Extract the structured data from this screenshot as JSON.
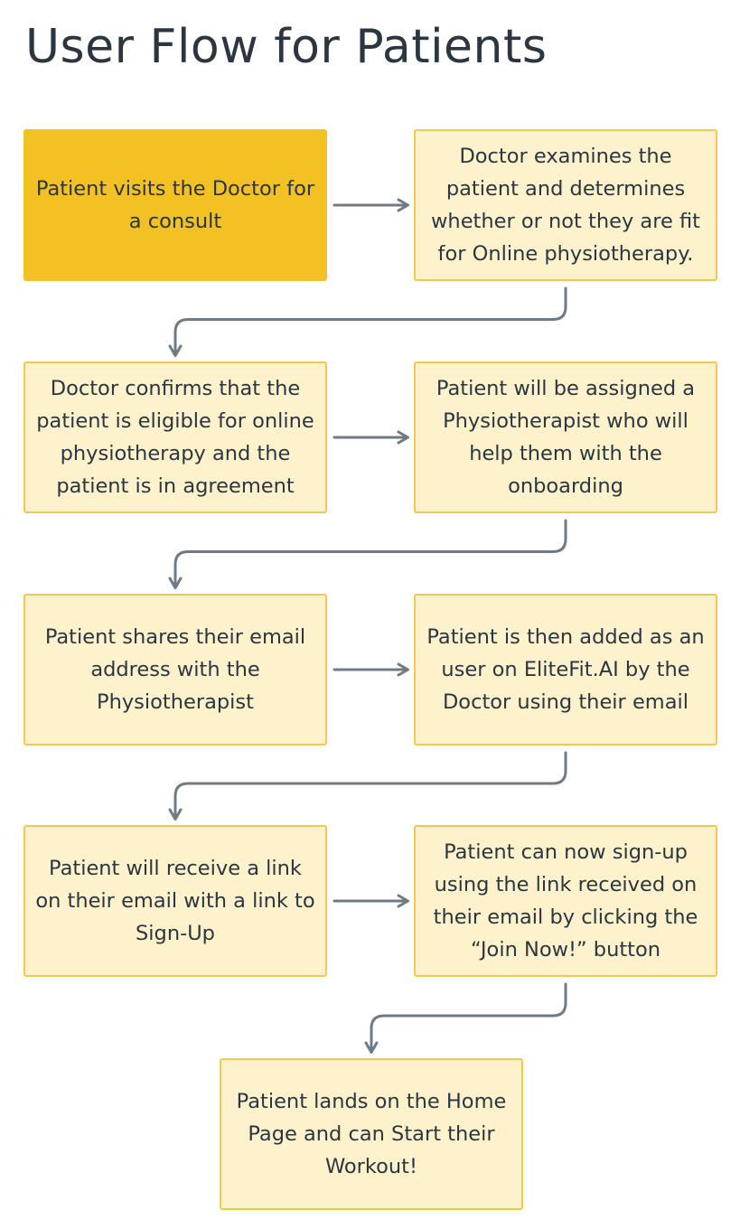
{
  "title": "User Flow for Patients",
  "colors": {
    "start_fill": "#f4c124",
    "step_fill": "#fdf2cc",
    "step_border": "#f2c94c",
    "connector": "#6e7b87",
    "text": "#2b3640"
  },
  "steps": [
    {
      "id": "visit",
      "text": "Patient visits the Doctor for a consult"
    },
    {
      "id": "examine",
      "text": "Doctor examines the patient and determines whether or not they are fit for Online physiotherapy."
    },
    {
      "id": "confirm",
      "text": "Doctor confirms that the patient is eligible for online physiotherapy and the patient is in agreement"
    },
    {
      "id": "assign",
      "text": "Patient will be assigned a Physiotherapist who will help them with the onboarding"
    },
    {
      "id": "share-email",
      "text": "Patient shares their email address with the Physiotherapist"
    },
    {
      "id": "add-user",
      "text": "Patient is then added as an user on EliteFit.AI by the Doctor using their email"
    },
    {
      "id": "receive-link",
      "text": "Patient will receive a link on their email with a link to Sign-Up"
    },
    {
      "id": "sign-up",
      "text": "Patient can now sign-up using the link received on their email by clicking the “Join Now!” button"
    },
    {
      "id": "home",
      "text": "Patient lands on the Home Page and can Start their Workout!"
    }
  ],
  "connections": [
    [
      "visit",
      "examine"
    ],
    [
      "examine",
      "confirm"
    ],
    [
      "confirm",
      "assign"
    ],
    [
      "assign",
      "share-email"
    ],
    [
      "share-email",
      "add-user"
    ],
    [
      "add-user",
      "receive-link"
    ],
    [
      "receive-link",
      "sign-up"
    ],
    [
      "sign-up",
      "home"
    ]
  ]
}
